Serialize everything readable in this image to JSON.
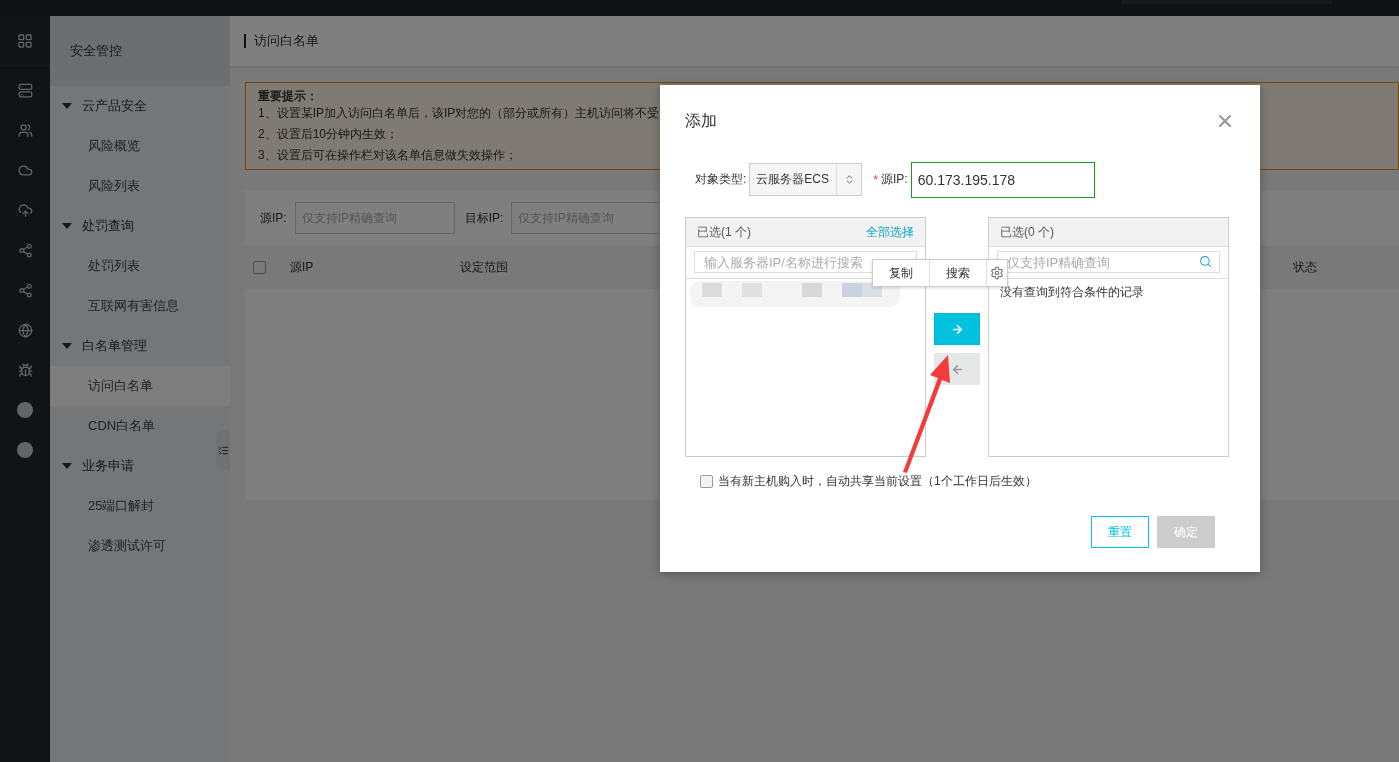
{
  "sidebar": {
    "title": "安全管控",
    "groups": [
      {
        "label": "云产品安全",
        "expanded": true,
        "children": [
          {
            "label": "风险概览",
            "selected": false
          },
          {
            "label": "风险列表",
            "selected": false
          }
        ]
      },
      {
        "label": "处罚查询",
        "expanded": true,
        "children": [
          {
            "label": "处罚列表",
            "selected": false
          },
          {
            "label": "互联网有害信息",
            "selected": false
          }
        ]
      },
      {
        "label": "白名单管理",
        "expanded": true,
        "children": [
          {
            "label": "访问白名单",
            "selected": true
          },
          {
            "label": "CDN白名单",
            "selected": false
          }
        ]
      },
      {
        "label": "业务申请",
        "expanded": true,
        "children": [
          {
            "label": "25端口解封",
            "selected": false
          },
          {
            "label": "渗透测试许可",
            "selected": false
          }
        ]
      }
    ]
  },
  "page": {
    "title": "访问白名单",
    "notice": {
      "heading": "重要提示：",
      "lines": [
        "1、设置某IP加入访问白名单后，该IP对您的（部分或所有）主机访问将不受",
        "2、设置后10分钟内生效；",
        "3、设置后可在操作栏对该名单信息做失效操作；"
      ]
    },
    "filters": [
      {
        "label": "源IP:",
        "placeholder": "仅支持IP精确查询"
      },
      {
        "label": "目标IP:",
        "placeholder": "仅支持IP精确查询"
      }
    ],
    "table": {
      "select_all_checked": false,
      "columns": [
        "源IP",
        "设定范围",
        "状态"
      ]
    }
  },
  "dialog": {
    "title": "添加",
    "object_type": {
      "label": "对象类型:",
      "value": "云服务器ECS"
    },
    "source_ip": {
      "required_mark": "*",
      "label": "源IP:",
      "value": "60.173.195.178"
    },
    "left_panel": {
      "header": "已选(1 个)",
      "action": "全部选择",
      "search_placeholder": "输入服务器IP/名称进行搜索"
    },
    "right_panel": {
      "header": "已选(0 个)",
      "search_placeholder": "仅支持IP精确查询",
      "empty_text": "没有查询到符合条件的记录"
    },
    "move_right_enabled": true,
    "move_left_enabled": false,
    "share_option": {
      "label": "当有新主机购入时，自动共享当前设置（1个工作日后生效）",
      "checked": false
    },
    "buttons": [
      {
        "label": "重置",
        "kind": "outline"
      },
      {
        "label": "确定",
        "kind": "disabled"
      }
    ]
  },
  "selection_toolbar": {
    "buttons": [
      "复制",
      "搜索"
    ]
  }
}
